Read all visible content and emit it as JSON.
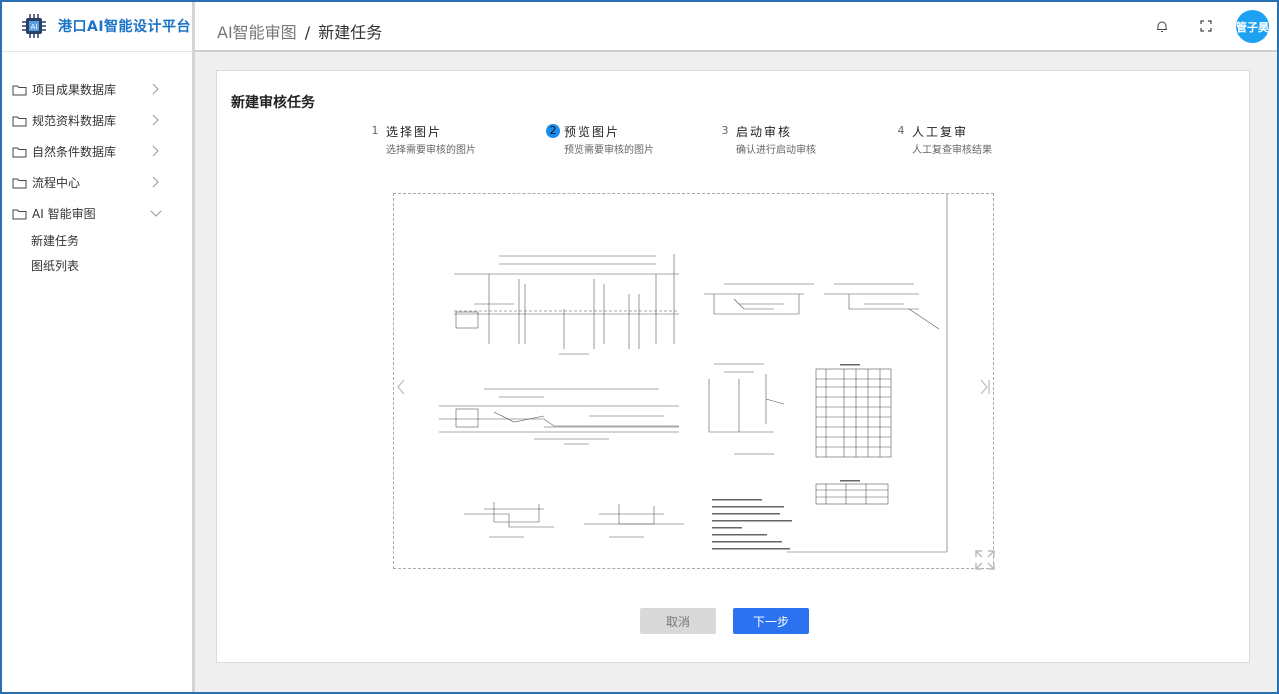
{
  "app": {
    "title": "港口AI智能设计平台"
  },
  "sidebar": {
    "items": [
      {
        "label": "项目成果数据库"
      },
      {
        "label": "规范资料数据库"
      },
      {
        "label": "自然条件数据库"
      },
      {
        "label": "流程中心"
      },
      {
        "label": "AI 智能审图"
      }
    ],
    "sub_items": [
      {
        "label": "新建任务"
      },
      {
        "label": "图纸列表"
      }
    ]
  },
  "header": {
    "breadcrumb_parent": "AI智能审图",
    "breadcrumb_sep": "/",
    "breadcrumb_current": "新建任务",
    "user_name": "管子昊"
  },
  "card": {
    "title": "新建审核任务",
    "steps": [
      {
        "num": "1",
        "title": "选择图片",
        "desc": "选择需要审核的图片"
      },
      {
        "num": "2",
        "title": "预览图片",
        "desc": "预览需要审核的图片"
      },
      {
        "num": "3",
        "title": "启动审核",
        "desc": "确认进行启动审核"
      },
      {
        "num": "4",
        "title": "人工复审",
        "desc": "人工复查审核结果"
      }
    ],
    "cancel_label": "取消",
    "next_label": "下一步"
  },
  "icons": {
    "logo": "chip-logo-icon",
    "folder": "folder-icon",
    "chevron_right": "chevron-right-icon",
    "chevron_down": "chevron-down-icon",
    "bell": "bell-icon",
    "fullscreen": "fullscreen-icon",
    "prev": "chevron-left-icon",
    "next": "chevron-right-bar-icon",
    "expand": "expand-icon"
  },
  "colors": {
    "brand": "#1a73c7",
    "primary_button": "#2b72f0",
    "active_step": "#1a8df0",
    "avatar": "#1da1f2"
  }
}
